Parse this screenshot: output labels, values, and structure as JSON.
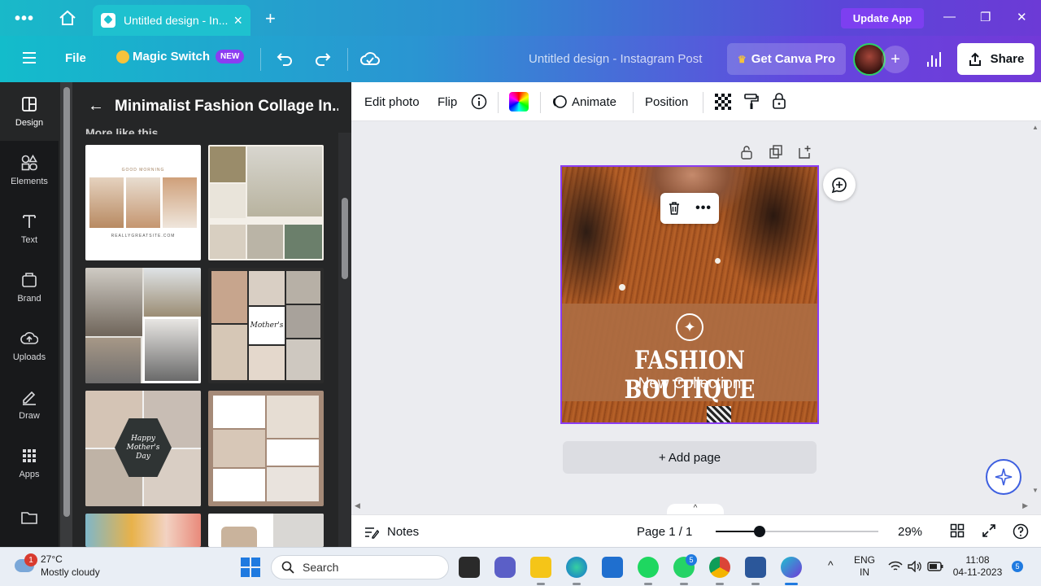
{
  "browser": {
    "tab_title": "Untitled design - In...",
    "update_app": "Update App",
    "win_minimize": "—",
    "win_restore": "❐",
    "win_close": "✕"
  },
  "topbar": {
    "file": "File",
    "magic_switch": "Magic Switch",
    "new_badge": "NEW",
    "doc_title": "Untitled design - Instagram Post",
    "get_pro": "Get Canva Pro",
    "share": "Share"
  },
  "rail": {
    "items": [
      {
        "label": "Design",
        "icon": "design-icon"
      },
      {
        "label": "Elements",
        "icon": "elements-icon"
      },
      {
        "label": "Text",
        "icon": "text-icon"
      },
      {
        "label": "Brand",
        "icon": "brand-icon"
      },
      {
        "label": "Uploads",
        "icon": "uploads-icon"
      },
      {
        "label": "Draw",
        "icon": "draw-icon"
      },
      {
        "label": "Apps",
        "icon": "apps-icon"
      },
      {
        "label": "Projects",
        "icon": "folder-icon"
      }
    ]
  },
  "panel": {
    "title": "Minimalist Fashion Collage In...",
    "section": "More like this",
    "templates": [
      {
        "name": "good-morning",
        "heading": "GOOD MORNING",
        "footer": "REALLYGREATSITE.COM"
      },
      {
        "name": "interior-collage"
      },
      {
        "name": "beach-collage"
      },
      {
        "name": "mothers-collage",
        "label": "Mother's"
      },
      {
        "name": "happy-mothers-day",
        "label": "Happy Mother's Day"
      },
      {
        "name": "beige-collage"
      },
      {
        "name": "flowers-collage"
      },
      {
        "name": "coffee-collage"
      }
    ]
  },
  "toolbar": {
    "edit_photo": "Edit photo",
    "flip": "Flip",
    "animate": "Animate",
    "position": "Position"
  },
  "canvas": {
    "headline": "FASHION BOUTIQUE",
    "subheadline": "New Collection",
    "add_page": "+ Add page"
  },
  "bottombar": {
    "notes": "Notes",
    "page": "Page 1 / 1",
    "zoom_value": 29,
    "zoom": "29%"
  },
  "taskbar": {
    "temperature": "27°C",
    "weather": "Mostly cloudy",
    "weather_badge": "1",
    "search": "Search",
    "whatsapp_badge": "5",
    "lang_top": "ENG",
    "lang_bottom": "IN",
    "time": "11:08",
    "date": "04-11-2023",
    "notification_count": "5"
  }
}
